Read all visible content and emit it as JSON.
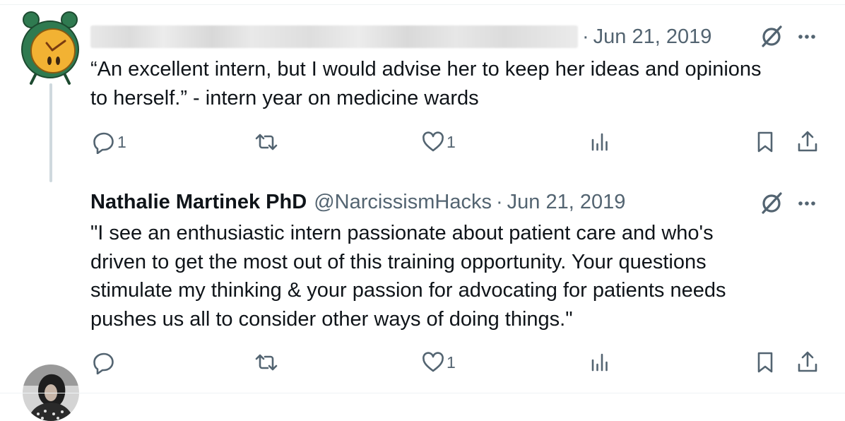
{
  "tweets": [
    {
      "author_name": "",
      "dot": "·",
      "date": "Jun 21, 2019",
      "text": "“An excellent intern, but I would advise her to keep her ideas and opinions\nto herself.” - intern year on medicine wards",
      "replies": "1",
      "reposts": "",
      "likes": "1"
    },
    {
      "author_name": "Nathalie Martinek PhD",
      "handle": "@NarcissismHacks",
      "dot": "·",
      "date": "Jun 21, 2019",
      "text": "\"I see an enthusiastic intern passionate about patient care and who's\ndriven to get the most out of this training opportunity. Your questions\nstimulate my thinking & your passion for advocating for patients needs\npushes us all to consider other ways of doing things.\"",
      "replies": "",
      "reposts": "",
      "likes": "1"
    }
  ],
  "icons": {
    "reply": "speech-bubble",
    "repost": "repost-arrows",
    "like": "heart-outline",
    "views": "bar-chart",
    "bookmark": "bookmark",
    "share": "upload-arrow",
    "grok": "grok-logo",
    "more": "horizontal-ellipsis"
  },
  "colors": {
    "text": "#0f1419",
    "secondary": "#536471",
    "thread_line": "#cfd9de",
    "avatar_alarm_green": "#2f7a50",
    "avatar_face_yellow": "#f2b233"
  }
}
